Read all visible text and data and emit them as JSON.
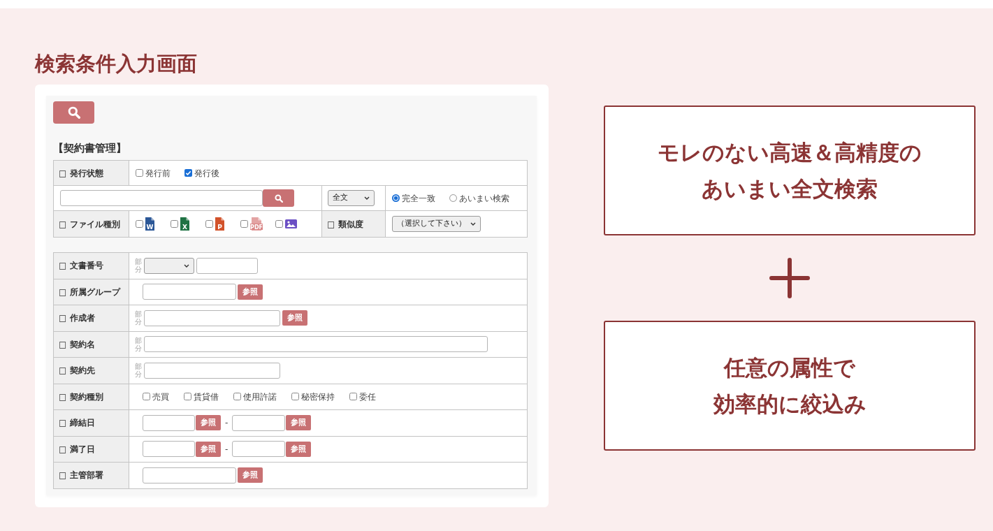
{
  "page_title": "検索条件入力画面",
  "search_form": {
    "section_title": "【契約書管理】",
    "status": {
      "label": "□ 発行状態",
      "options": [
        {
          "label": "発行前",
          "checked": false
        },
        {
          "label": "発行後",
          "checked": true
        }
      ]
    },
    "keyword": {
      "scope": "全文",
      "match_modes": [
        {
          "label": "完全一致",
          "selected": true
        },
        {
          "label": "あいまい検索",
          "selected": false
        }
      ]
    },
    "file_types": {
      "label": "□ ファイル種別",
      "options": [
        {
          "kind": "word",
          "mark": "W",
          "checked": false
        },
        {
          "kind": "excel",
          "mark": "X",
          "checked": false
        },
        {
          "kind": "powerpoint",
          "mark": "P",
          "checked": false
        },
        {
          "kind": "pdf",
          "mark": "PDF",
          "checked": false
        },
        {
          "kind": "image",
          "checked": false
        }
      ]
    },
    "similarity": {
      "label": "□ 類似度",
      "value": "（選択して下さい）"
    },
    "fields": [
      {
        "label": "□ 文書番号",
        "kind": "number",
        "partial": "部分"
      },
      {
        "label": "□ 所属グループ",
        "kind": "lookup",
        "button": "参照"
      },
      {
        "label": "□ 作成者",
        "kind": "lookup",
        "partial": "部分",
        "button": "参照"
      },
      {
        "label": "□ 契約名",
        "kind": "text_wide",
        "partial": "部分"
      },
      {
        "label": "□ 契約先",
        "kind": "text",
        "partial": "部分"
      },
      {
        "label": "□ 契約種別",
        "kind": "checkboxes",
        "options": [
          {
            "label": "売買",
            "checked": false
          },
          {
            "label": "賃貸借",
            "checked": false
          },
          {
            "label": "使用許諾",
            "checked": false
          },
          {
            "label": "秘密保持",
            "checked": false
          },
          {
            "label": "委任",
            "checked": false
          }
        ]
      },
      {
        "label": "□ 締結日",
        "kind": "date_range",
        "buttons": [
          "参照",
          "参照"
        ],
        "separator": "-"
      },
      {
        "label": "□ 満了日",
        "kind": "date_range",
        "buttons": [
          "参照",
          "参照"
        ],
        "separator": "-"
      },
      {
        "label": "□ 主管部署",
        "kind": "lookup",
        "button": "参照"
      }
    ]
  },
  "features": [
    {
      "lines": [
        "モレのない高速＆高精度の",
        "あいまい全文検索"
      ]
    },
    {
      "lines": [
        "任意の属性で",
        "効率的に絞込み"
      ]
    }
  ]
}
